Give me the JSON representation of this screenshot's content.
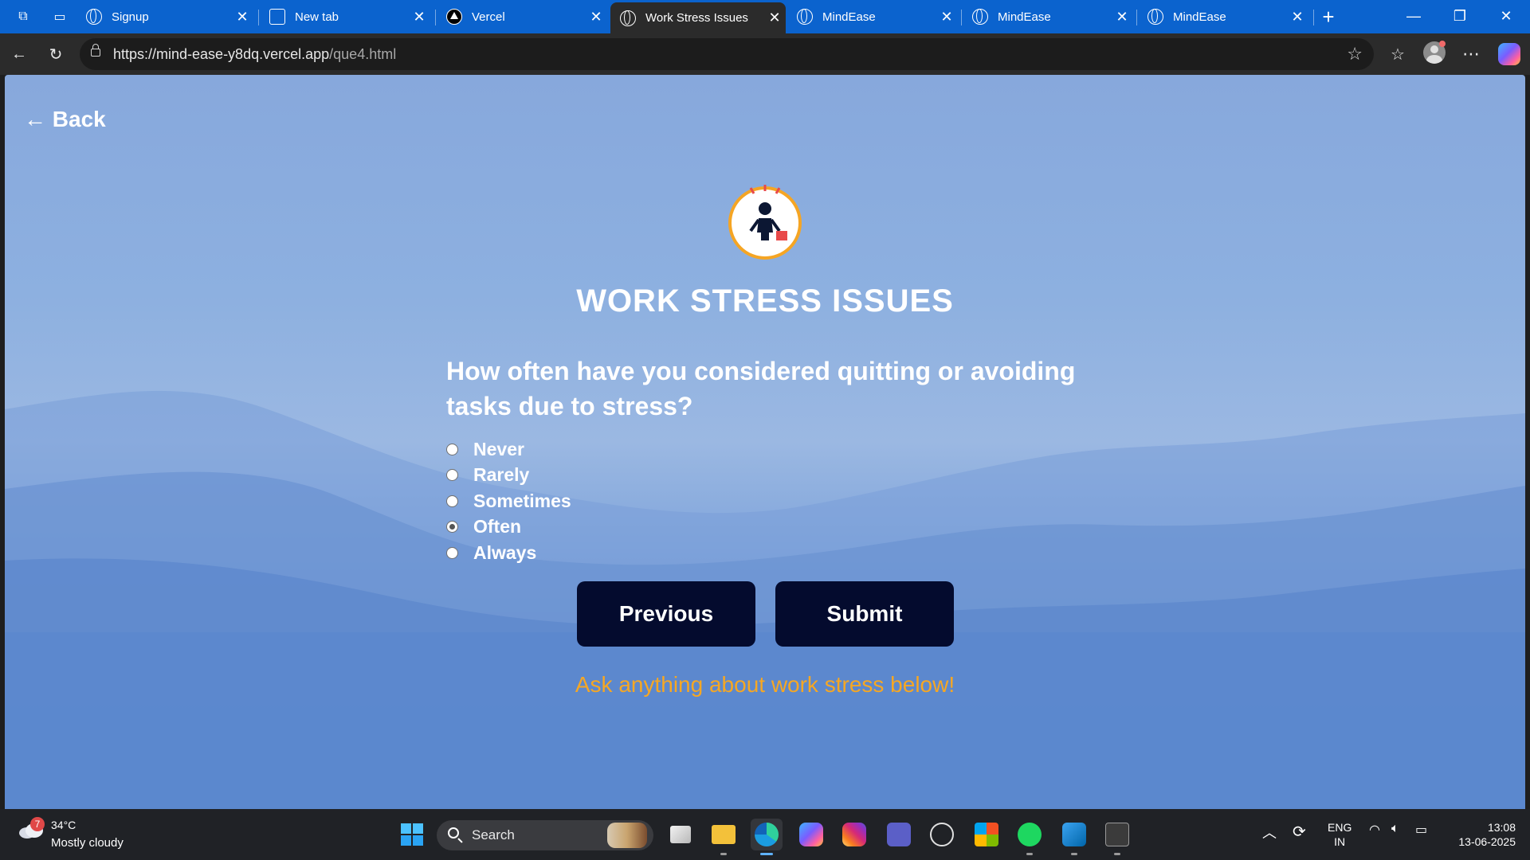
{
  "browser": {
    "tabs": [
      {
        "title": "Signup",
        "icon": "globe-icon",
        "active": false
      },
      {
        "title": "New tab",
        "icon": "new-tab-icon",
        "active": false
      },
      {
        "title": "Vercel",
        "icon": "vercel-icon",
        "active": false
      },
      {
        "title": "Work Stress Issues",
        "icon": "globe-icon",
        "active": true
      },
      {
        "title": "MindEase",
        "icon": "globe-icon",
        "active": false
      },
      {
        "title": "MindEase",
        "icon": "globe-icon",
        "active": false
      },
      {
        "title": "MindEase",
        "icon": "globe-icon",
        "active": false
      }
    ],
    "url_host": "https://mind-ease-y8dq.vercel.app",
    "url_path": "/que4.html",
    "accent_color": "#0b63ce"
  },
  "page": {
    "back_label": "← Back",
    "title": "WORK STRESS ISSUES",
    "question": "How often have you considered quitting or avoiding tasks due to stress?",
    "options": [
      {
        "label": "Never",
        "checked": false
      },
      {
        "label": "Rarely",
        "checked": false
      },
      {
        "label": "Sometimes",
        "checked": false
      },
      {
        "label": "Often",
        "checked": true
      },
      {
        "label": "Always",
        "checked": false
      }
    ],
    "previous_label": "Previous",
    "submit_label": "Submit",
    "ask_text": "Ask anything about work stress below!",
    "button_color": "#040b2e",
    "ask_text_color": "#f6a723",
    "logo_icon": "stressed-worker-icon"
  },
  "taskbar": {
    "weather_badge": "7",
    "temperature": "34°C",
    "weather_desc": "Mostly cloudy",
    "search_label": "Search",
    "language_line1": "ENG",
    "language_line2": "IN",
    "time": "13:08",
    "date": "13-06-2025"
  }
}
